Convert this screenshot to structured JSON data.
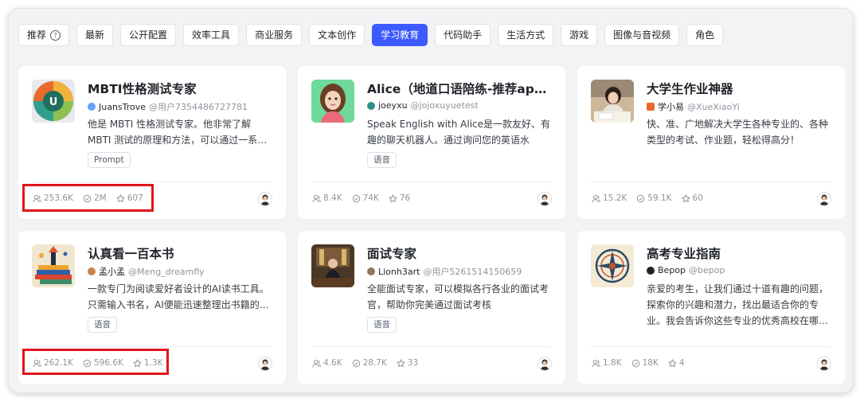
{
  "tabs": [
    {
      "label": "推荐",
      "active": false,
      "icon": "help-circle-icon"
    },
    {
      "label": "最新",
      "active": false
    },
    {
      "label": "公开配置",
      "active": false
    },
    {
      "label": "效率工具",
      "active": false
    },
    {
      "label": "商业服务",
      "active": false
    },
    {
      "label": "文本创作",
      "active": false
    },
    {
      "label": "学习教育",
      "active": true
    },
    {
      "label": "代码助手",
      "active": false
    },
    {
      "label": "生活方式",
      "active": false
    },
    {
      "label": "游戏",
      "active": false
    },
    {
      "label": "图像与音视频",
      "active": false
    },
    {
      "label": "角色",
      "active": false
    }
  ],
  "cards": [
    {
      "title": "MBTI性格测试专家",
      "author": "JuansTrove",
      "handle": "@用户7354486727781",
      "desc": "他是 MBTI 性格测试专家。他非常了解 MBTI 测试的原理和方法，可以通过一系…",
      "tag": "Prompt",
      "users": "253.6K",
      "chats": "2M",
      "stars": "607",
      "thumb": "mbti-logo",
      "author_icon_color": "#6aa0ff"
    },
    {
      "title": "Alice（地道口语陪练-推荐app…",
      "author": "joeyxu",
      "handle": "@jojoxuyuetest",
      "desc": "Speak English with Alice是一款友好、有趣的聊天机器人。通过询问您的英语水平、…",
      "tag": "语音",
      "users": "8.4K",
      "chats": "74K",
      "stars": "76",
      "thumb": "alice-avatar",
      "author_icon_color": "#2b8f8a"
    },
    {
      "title": "大学生作业神器",
      "author": "学小易",
      "handle": "@XueXiaoYi",
      "desc": "快、准、广地解决大学生各种专业的、各种类型的考试、作业题，轻松得高分！",
      "tag": "",
      "users": "15.2K",
      "chats": "59.1K",
      "stars": "60",
      "thumb": "student-photo",
      "author_icon_color": "#e8692c"
    },
    {
      "title": "认真看一百本书",
      "author": "孟小孟",
      "handle": "@Meng_dreamfly",
      "desc": "一款专门为阅读爱好者设计的AI读书工具。只需输入书名，AI便能迅速整理出书籍的…",
      "tag": "语音",
      "users": "262.1K",
      "chats": "596.6K",
      "stars": "1.3K",
      "thumb": "books-illustration",
      "author_icon_color": "#c9834a"
    },
    {
      "title": "面试专家",
      "author": "Lionh3art",
      "handle": "@用户5261514150659",
      "desc": "全能面试专家，可以模拟各行各业的面试考官，帮助你完美通过面试考核",
      "tag": "语音",
      "users": "4.6K",
      "chats": "28.7K",
      "stars": "33",
      "thumb": "interview-photo",
      "author_icon_color": "#8a7a5a"
    },
    {
      "title": "高考专业指南",
      "author": "Bepop",
      "handle": "@bepop",
      "desc": "亲爱的考生，让我们通过十道有趣的问题，探索你的兴趣和潜力，找出最适合你的专业。我会告诉你这些专业的优秀高校在哪…",
      "tag": "",
      "users": "1.8K",
      "chats": "18K",
      "stars": "4",
      "thumb": "compass-emblem",
      "author_icon_color": "#1f2329"
    }
  ]
}
